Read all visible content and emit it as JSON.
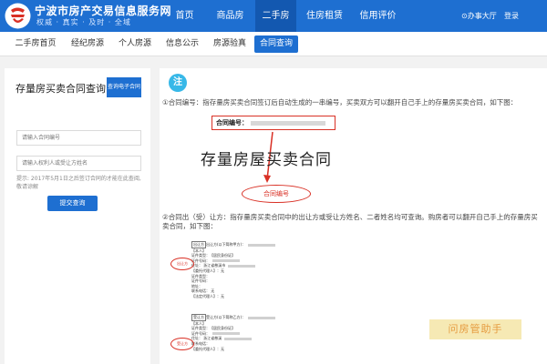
{
  "header": {
    "site_title": "宁波市房产交易信息服务网",
    "site_slogan": "权威 · 真实 · 及时 · 全域",
    "nav": [
      {
        "label": "首页"
      },
      {
        "label": "商品房"
      },
      {
        "label": "二手房"
      },
      {
        "label": "住房租赁"
      },
      {
        "label": "信用评价"
      }
    ],
    "active_nav": "二手房",
    "office_label": "办事大厅",
    "login_label": "登录"
  },
  "subnav": {
    "items": [
      {
        "label": "二手房首页"
      },
      {
        "label": "经纪房源"
      },
      {
        "label": "个人房源"
      },
      {
        "label": "信息公示"
      },
      {
        "label": "房源验真"
      },
      {
        "label": "合同查询"
      }
    ],
    "active": "合同查询"
  },
  "left_panel": {
    "title": "存量房买卖合同查询",
    "e_contract_button": "查询电子合同",
    "contract_no_placeholder": "请输入合同编号",
    "name_placeholder": "请输入权利人或受让方姓名",
    "hint": "提示: 2017年5月1日之后签订合同的才能在此查阅,敬请谅解",
    "submit_label": "提交查询"
  },
  "content": {
    "note_label": "注",
    "step1": "①合同编号：指存量房买卖合同签订后自动生成的一串编号，买卖双方可以翻开自己手上的存量房买卖合同，如下图：",
    "contract_label": "合同编号：",
    "doc_title": "存量房屋买卖合同",
    "contract_no_tag": "合同编号",
    "step2": "②合同出（受）让方：指存量房买卖合同中的出让方或受让方姓名、二者姓名均可查询。购房者可以翻开自己手上的存量房买卖合同，如下图：",
    "seller_block": {
      "tag": "出让方",
      "lines": [
        "出让方(以下简称甲方)：",
        "【本人】",
        "证件类型：【居民身份证】",
        "证件号码：",
        "住址：  浙江省慈溪市",
        "【委托代理人】：无",
        "证件类型：",
        "证件号码：",
        "地址：",
        "联系电话：  无",
        "【法定代理人】：无"
      ]
    },
    "buyer_block": {
      "tag": "受让方",
      "lines": [
        "受让方(以下简称乙方)：",
        "【本人】",
        "证件类型：【居民身份证】",
        "证件号码：",
        "住址：  浙江省慈溪",
        "联系电话：",
        "【委托代理人】：无"
      ]
    },
    "seller_oval": "出让方",
    "buyer_oval": "受让方",
    "watermark": "问房管助手"
  },
  "colors": {
    "primary": "#1e6fd1",
    "primary_dark": "#1358b0",
    "accent_red": "#d93025",
    "note_blue": "#37b8e8",
    "watermark_bg": "#f5e6a8",
    "watermark_fg": "#e28a1e"
  }
}
